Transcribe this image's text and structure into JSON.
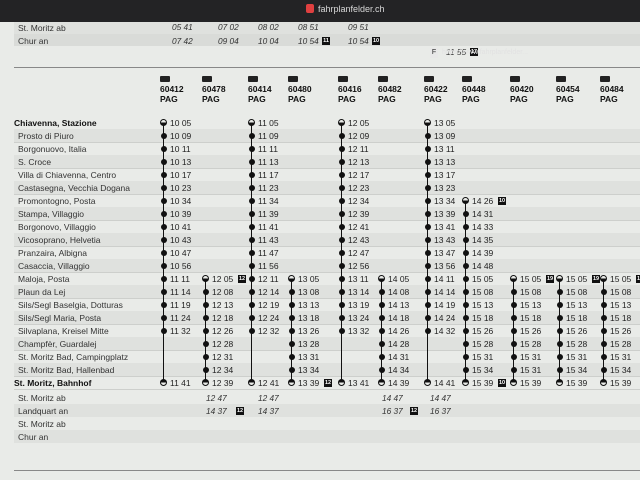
{
  "browser": {
    "url": "fahrplanfelder.ch",
    "tab_url": "https://www.fahrplanfelder..."
  },
  "top_fragment": {
    "stations": [
      "St. Moritz ab",
      "Chur an"
    ],
    "times_row1": [
      "05 41",
      "07 02",
      "08 02",
      "08 51",
      "09 51"
    ],
    "times_row2": [
      "07 42",
      "09 04",
      "10 04",
      "10 54",
      "10 54",
      "11 55"
    ],
    "badges": [
      "11",
      "10",
      "17"
    ]
  },
  "trains": [
    {
      "num": "60412",
      "op": "PAG"
    },
    {
      "num": "60478",
      "op": "PAG"
    },
    {
      "num": "60414",
      "op": "PAG"
    },
    {
      "num": "60480",
      "op": "PAG"
    },
    {
      "num": "60416",
      "op": "PAG"
    },
    {
      "num": "60482",
      "op": "PAG"
    },
    {
      "num": "60422",
      "op": "PAG"
    },
    {
      "num": "60448",
      "op": "PAG"
    },
    {
      "num": "60420",
      "op": "PAG"
    },
    {
      "num": "60454",
      "op": "PAG"
    },
    {
      "num": "60484",
      "op": "PAG"
    }
  ],
  "stops": [
    "Chiavenna, Stazione",
    "Prosto di Piuro",
    "Borgonuovo, Italia",
    "S. Croce",
    "Villa di Chiavenna, Centro",
    "Castasegna, Vecchia Dogana",
    "Promontogno, Posta",
    "Stampa, Villaggio",
    "Borgonovo, Villaggio",
    "Vicosoprano, Helvetia",
    "Pranzaira, Albigna",
    "Casaccia, Villaggio",
    "Maloja, Posta",
    "Plaun da Lej",
    "Sils/Segl Baselgia, Dotturas",
    "Sils/Segl Maria, Posta",
    "Silvaplana, Kreisel Mitte",
    "Champfèr, Guardalej",
    "St. Moritz Bad, Campingplatz",
    "St. Moritz Bad, Hallenbad",
    "St. Moritz, Bahnhof"
  ],
  "connections": {
    "stations": [
      "St. Moritz ab",
      "Landquart an",
      "St. Moritz ab",
      "Chur an"
    ],
    "col1": [
      "12 47",
      "14 37"
    ],
    "col2": [
      "12 47",
      "14 37"
    ],
    "col3": [
      "14 47",
      "16 37"
    ],
    "col4": [
      "14 47",
      "16 37"
    ],
    "badges": [
      "12",
      "12"
    ]
  },
  "cols": {
    "c1": [
      "10 05",
      "10 09",
      "10 11",
      "10 13",
      "10 17",
      "10 23",
      "10 34",
      "10 39",
      "10 41",
      "10 43",
      "10 47",
      "10 56",
      "11 11",
      "11 14",
      "11 19",
      "11 24",
      "11 32",
      "",
      "",
      "",
      "11 41"
    ],
    "c2": [
      "",
      "",
      "",
      "",
      "",
      "",
      "",
      "",
      "",
      "",
      "",
      "",
      "12 05",
      "12 08",
      "12 13",
      "12 18",
      "12 26",
      "12 28",
      "12 31",
      "12 34",
      "12 39"
    ],
    "c3": [
      "11 05",
      "11 09",
      "11 11",
      "11 13",
      "11 17",
      "11 23",
      "11 34",
      "11 39",
      "11 41",
      "11 43",
      "11 47",
      "11 56",
      "12 11",
      "12 14",
      "12 19",
      "12 24",
      "12 32",
      "",
      "",
      "",
      "12 41"
    ],
    "c4": [
      "",
      "",
      "",
      "",
      "",
      "",
      "",
      "",
      "",
      "",
      "",
      "",
      "13 05",
      "13 08",
      "13 13",
      "13 18",
      "13 26",
      "13 28",
      "13 31",
      "13 34",
      "13 39"
    ],
    "c5": [
      "12 05",
      "12 09",
      "12 11",
      "12 13",
      "12 17",
      "12 23",
      "12 34",
      "12 39",
      "12 41",
      "12 43",
      "12 47",
      "12 56",
      "13 11",
      "13 14",
      "13 19",
      "13 24",
      "13 32",
      "",
      "",
      "",
      "13 41"
    ],
    "c6": [
      "",
      "",
      "",
      "",
      "",
      "",
      "",
      "",
      "",
      "",
      "",
      "",
      "14 05",
      "14 08",
      "14 13",
      "14 18",
      "14 26",
      "14 28",
      "14 31",
      "14 34",
      "14 39"
    ],
    "c7": [
      "13 05",
      "13 09",
      "13 11",
      "13 13",
      "13 17",
      "13 23",
      "13 34",
      "13 39",
      "13 41",
      "13 43",
      "13 47",
      "13 56",
      "14 11",
      "14 14",
      "14 19",
      "14 24",
      "14 32",
      "",
      "",
      "",
      "14 41"
    ],
    "c8": [
      "",
      "",
      "",
      "",
      "",
      "",
      "14 26",
      "14 31",
      "14 33",
      "14 35",
      "14 39",
      "14 48",
      "15 05",
      "15 08",
      "15 13",
      "15 18",
      "15 26",
      "15 28",
      "15 31",
      "15 34",
      "15 39"
    ],
    "c9": [
      "",
      "",
      "",
      "",
      "",
      "",
      "",
      "",
      "",
      "",
      "",
      "",
      "15 05",
      "15 08",
      "15 13",
      "15 18",
      "15 26",
      "15 28",
      "15 31",
      "15 31",
      "15 39"
    ],
    "c10": [
      "",
      "",
      "",
      "",
      "",
      "",
      "",
      "",
      "",
      "",
      "",
      "",
      "15 05",
      "15 08",
      "15 13",
      "15 18",
      "15 26",
      "15 28",
      "15 31",
      "15 34",
      "15 39"
    ],
    "c11": [
      "",
      "",
      "",
      "",
      "",
      "",
      "",
      "",
      "",
      "",
      "",
      "",
      "15 05",
      "15 08",
      "15 13",
      "15 18",
      "15 26",
      "15 28",
      "15 31",
      "15 34",
      "15 39"
    ]
  },
  "row_badges": {
    "c2": "12",
    "c4": "12",
    "c8": "10",
    "c8b": "10",
    "c9": "19",
    "c10": "19",
    "c11": "19"
  }
}
